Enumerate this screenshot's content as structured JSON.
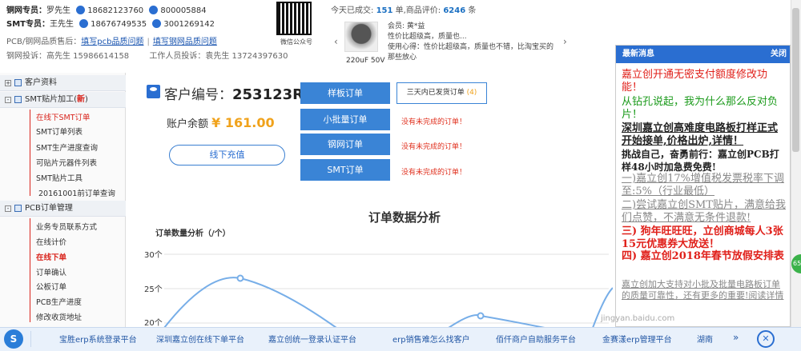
{
  "header": {
    "reps": [
      {
        "role": "铜网专员：",
        "name": "罗先生",
        "phone": "18682123760",
        "qq": "800005884"
      },
      {
        "role": "SMT专员：",
        "name": "王先生",
        "phone": "18676749535",
        "qq": "3001269142"
      }
    ],
    "quality_label": "PCB/钢网品质售后：",
    "quality_link_1": "填写pcb品质问题",
    "quality_link_2": "填写钢网品质问题",
    "complaint_1": "钢网投诉：高先生 15986614158",
    "complaint_2": "工作人员投诉：袁先生 13724397630",
    "qr_caption": "微信公众号",
    "today_prefix": "今天已成交: ",
    "today_count": "151",
    "today_mid": " 单,商品评价: ",
    "review_count": "6246",
    "review_suffix": " 条",
    "product_caption": "220uF 50V",
    "review_lines": [
      "会员: 黄*益",
      "性价比超级高，质量也...",
      "使用心得：性价比超级高，质量也不错，比淘宝买的",
      "那些放心"
    ],
    "arrow_left": "‹",
    "arrow_right": "›"
  },
  "leftnav": {
    "groups": [
      {
        "label": "客户资料",
        "toggle": "+"
      },
      {
        "label": "SMT贴片加工(",
        "new": "新",
        "close": ")",
        "toggle": "-"
      },
      {
        "label": "PCB订单管理",
        "toggle": "-"
      }
    ],
    "smt_items": [
      "在线下SMT订单",
      "SMT订单列表",
      "SMT生产进度查询",
      "可贴片元器件列表",
      "SMT贴片工具",
      "20161001前订单查询"
    ],
    "pcb_items": [
      "业务专员联系方式",
      "在线计价",
      "在线下单",
      "订单确认",
      "公板订单",
      "PCB生产进度",
      "修改收货地址"
    ]
  },
  "main": {
    "customer_label": "客户编号：",
    "customer_no": "253123R",
    "balance_label": "账户余额 ",
    "balance_amount": "¥ 161.00",
    "recharge": "线下充值",
    "buttons": [
      "样板订单",
      "小批量订单",
      "钢网订单",
      "SMT订单"
    ],
    "pending_label": "三天内已发货订单 ",
    "pending_count": "(4)",
    "no_order": "没有未完成的订单！"
  },
  "chart_data": {
    "type": "line",
    "title": "订单数据分析",
    "ylabel": "订单数量分析（/个）",
    "yticks": [
      "30个",
      "25个",
      "20个"
    ],
    "ylim": [
      20,
      30
    ],
    "grid": true
  },
  "news": {
    "title": "最新消息",
    "close": "关闭",
    "items": [
      {
        "text": "嘉立创开通无密支付额度修改功能！",
        "color": "#e0201a"
      },
      {
        "text": "从钻孔说起，我为什么那么反对负片！",
        "color": "#1a9a1a"
      },
      {
        "text": "深圳嘉立创高难度电路板打样正式开始接单,价格出炉,详情！",
        "color": "#222"
      },
      {
        "text": "挑战自己，奋勇前行：嘉立创PCB打样48小时加急费免费!",
        "color": "#222"
      },
      {
        "text": "一)嘉立创17%增值税发票税率下调至:5%（行业最低）",
        "color": "#888"
      },
      {
        "text": "二)尝试嘉立创SMT贴片，满意给我们点赞，不满意无条件退款!",
        "color": "#888"
      },
      {
        "text": "三) 狗年旺旺旺，立创商城每人3张15元优惠券大放送！",
        "color": "#e0201a"
      },
      {
        "text": "四) 嘉立创2018年春节放假安排表",
        "color": "#e0201a"
      },
      {
        "text": "嘉立创加大支持对小批及批量电路板订单的质量可靠性，还有更多的重要!阅读详情",
        "color": "#888"
      }
    ]
  },
  "bottombar": {
    "logo": "S",
    "links": [
      "宝胜erp系统登录平台",
      "深圳嘉立创在线下单平台",
      "嘉立创统一登录认证平台",
      "erp销售难怎么找客户",
      "佰仟商户自助服务平台",
      "金赛漾erp管理平台",
      "湖南"
    ],
    "close": "✕",
    "more": "»"
  },
  "watermark": "jingyan.baidu.com",
  "side_badge": "65"
}
